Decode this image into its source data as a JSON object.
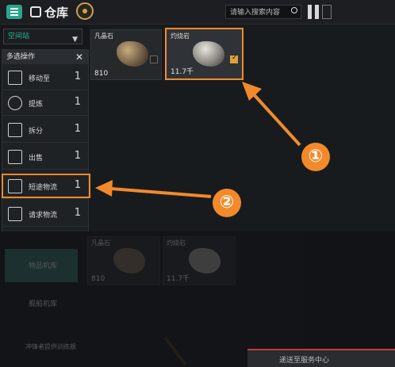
{
  "header": {
    "title": "仓库",
    "search_placeholder": "请输入搜索内容"
  },
  "filter": {
    "label": "空间站"
  },
  "multi_ops": {
    "title": "多选操作",
    "items": [
      {
        "label": "移动至",
        "count": "1",
        "icon": "move-icon"
      },
      {
        "label": "提炼",
        "count": "1",
        "icon": "refine-icon"
      },
      {
        "label": "拆分",
        "count": "1",
        "icon": "split-icon"
      },
      {
        "label": "出售",
        "count": "1",
        "icon": "sell-icon"
      },
      {
        "label": "短途物流",
        "count": "1",
        "icon": "logistics-icon"
      },
      {
        "label": "请求物流",
        "count": "1",
        "icon": "request-logistics-icon"
      }
    ]
  },
  "items": [
    {
      "name": "凡晶石",
      "qty": "810",
      "selected": false
    },
    {
      "name": "灼烧岩",
      "qty": "11.7千",
      "selected": true
    }
  ],
  "lower_items": [
    {
      "name": "凡晶石",
      "qty": "810"
    },
    {
      "name": "灼烧岩",
      "qty": "11.7千"
    }
  ],
  "lower_sidebar": {
    "items": [
      "物品机库",
      "舰船机库"
    ],
    "ship": "冲锋者提供训练舰"
  },
  "notice": {
    "text": "递送至服务中心"
  },
  "callouts": [
    "①",
    "②"
  ],
  "colors": {
    "accent": "#2aa58a",
    "highlight": "#f28a2b",
    "check": "#e0a13a"
  }
}
